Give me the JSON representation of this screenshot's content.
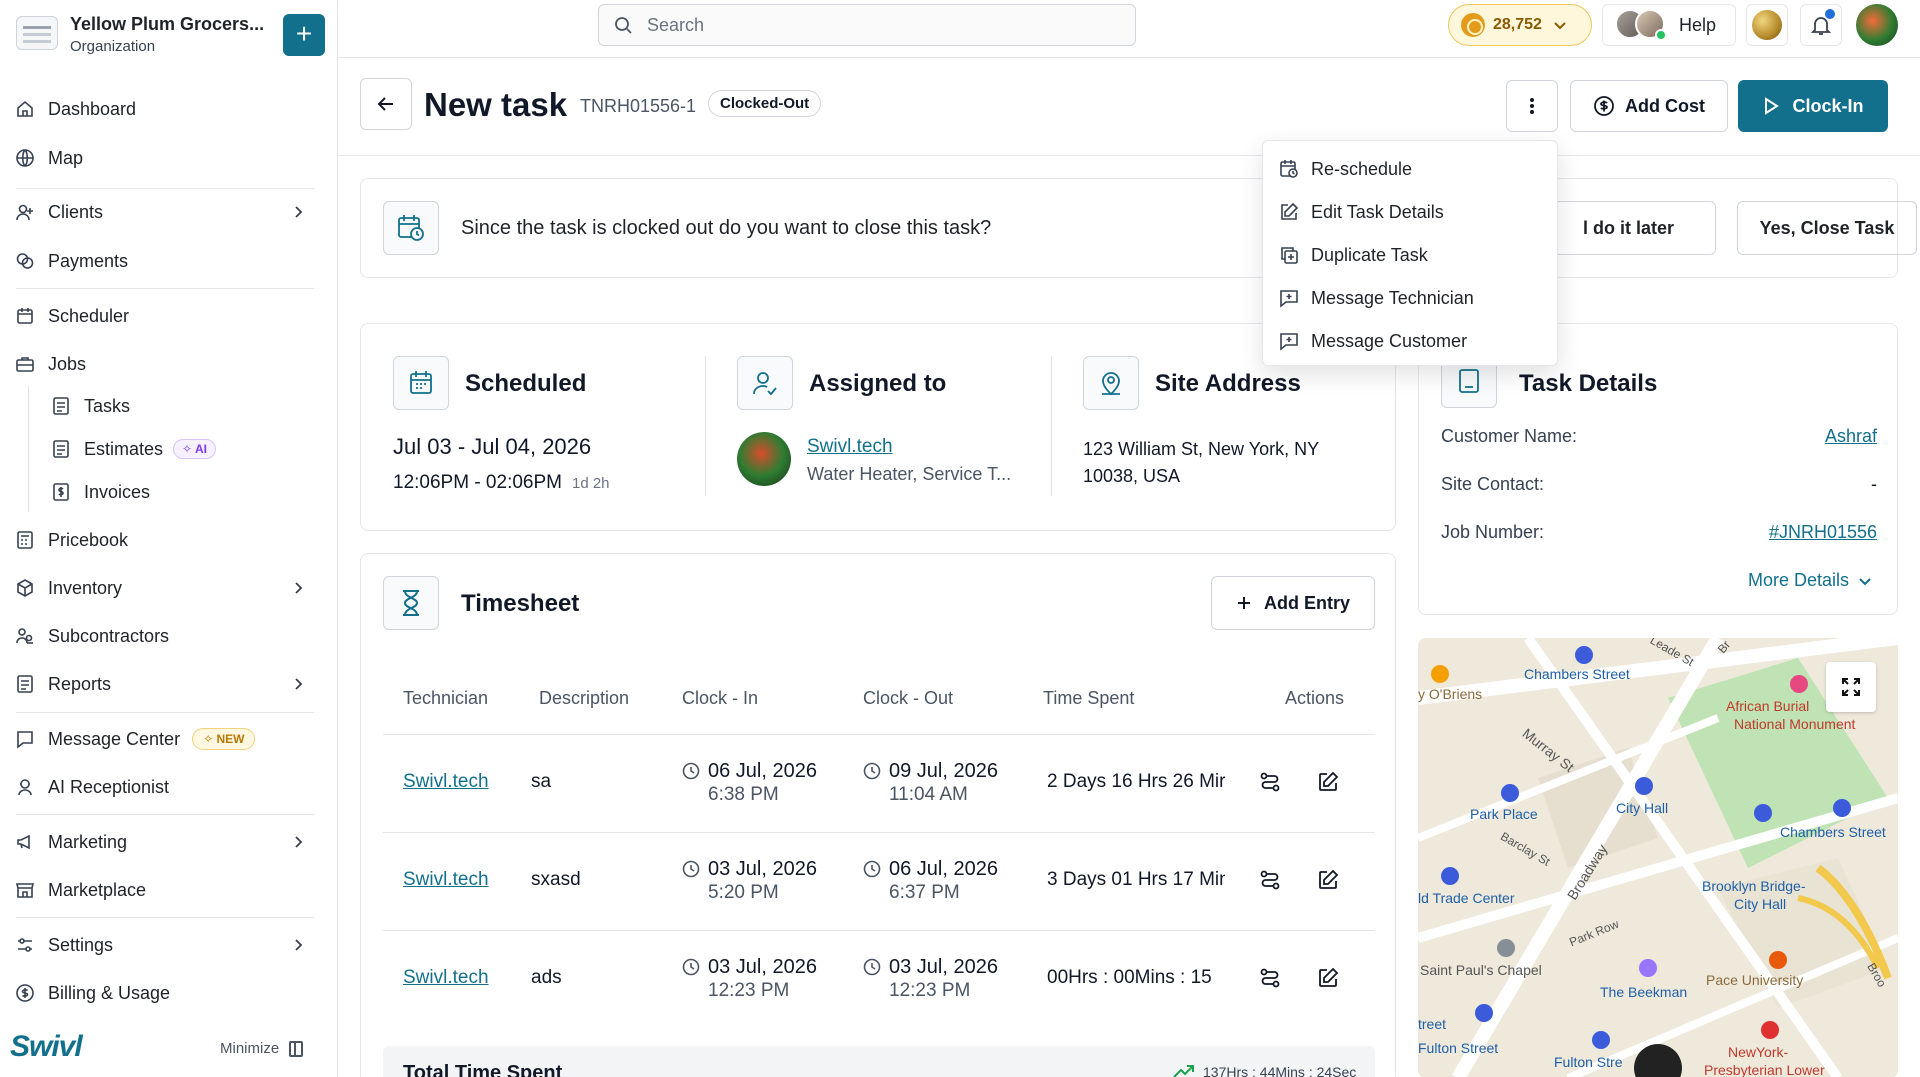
{
  "org": {
    "name": "Yellow Plum Grocers...",
    "subtitle": "Organization"
  },
  "sidebar": {
    "items": [
      {
        "label": "Dashboard"
      },
      {
        "label": "Map"
      },
      {
        "label": "Clients"
      },
      {
        "label": "Payments"
      },
      {
        "label": "Scheduler"
      },
      {
        "label": "Jobs"
      },
      {
        "label": "Tasks"
      },
      {
        "label": "Estimates",
        "badge": "AI"
      },
      {
        "label": "Invoices"
      },
      {
        "label": "Pricebook"
      },
      {
        "label": "Inventory"
      },
      {
        "label": "Subcontractors"
      },
      {
        "label": "Reports"
      },
      {
        "label": "Message Center",
        "badge": "NEW"
      },
      {
        "label": "AI Receptionist"
      },
      {
        "label": "Marketing"
      },
      {
        "label": "Marketplace"
      },
      {
        "label": "Settings"
      },
      {
        "label": "Billing & Usage"
      }
    ],
    "brand": "Swivl",
    "minimize_label": "Minimize"
  },
  "topbar": {
    "search_placeholder": "Search",
    "coins": "28,752",
    "help_label": "Help"
  },
  "header": {
    "title": "New task",
    "task_id": "TNRH01556-1",
    "status": "Clocked-Out",
    "add_cost_label": "Add Cost",
    "clock_in_label": "Clock-In"
  },
  "alert": {
    "text": "Since the task is clocked out do you want to close this task?",
    "later_label": "l do it later",
    "close_label": "Yes, Close Task"
  },
  "menu": {
    "items": [
      {
        "label": "Re-schedule"
      },
      {
        "label": "Edit Task Details"
      },
      {
        "label": "Duplicate Task"
      },
      {
        "label": "Message Technician"
      },
      {
        "label": "Message Customer"
      }
    ]
  },
  "info": {
    "scheduled": {
      "heading": "Scheduled",
      "date": "Jul 03 - Jul 04, 2026",
      "time": "12:06PM - 02:06PM",
      "duration": "1d 2h"
    },
    "assigned": {
      "heading": "Assigned to",
      "name": "Swivl.tech",
      "role": "Water Heater, Service T..."
    },
    "site": {
      "heading": "Site Address",
      "line1": "123 William St, New York, NY",
      "line2": "10038, USA"
    }
  },
  "task_details": {
    "heading": "Task Details",
    "rows": [
      {
        "label": "Customer Name:",
        "value": "Ashraf"
      },
      {
        "label": "Site Contact:",
        "value": "-"
      },
      {
        "label": "Job Number:",
        "value": "#JNRH01556"
      }
    ],
    "more_label": "More Details"
  },
  "map": {
    "labels": {
      "chambers1": "Chambers Street",
      "obriens": "y O'Briens",
      "african1": "African Burial",
      "african2": "National Monument",
      "murray": "Murray St",
      "cityhall": "City Hall",
      "parkplace": "Park Place",
      "chambers2": "Chambers Street",
      "barclay": "Barclay St",
      "broadway": "Broadway",
      "brooklyn1": "Brooklyn Bridge-",
      "brooklyn2": "City Hall",
      "trade": "ld Trade Center",
      "parkrow": "Park Row",
      "stpaul": "Saint Paul's Chapel",
      "pace": "Pace University",
      "beekman": "The Beekman",
      "treet": "treet",
      "fulton1": "Fulton Street",
      "fulton2": "Fulton Stre",
      "nyp1": "NewYork-",
      "nyp2": "Presbyterian Lower",
      "leade": "Leade St",
      "br": "Br",
      "broo": "Broo"
    }
  },
  "timesheet": {
    "title": "Timesheet",
    "add_entry_label": "Add Entry",
    "columns": [
      "Technician",
      "Description",
      "Clock - In",
      "Clock - Out",
      "Time Spent",
      "Actions"
    ],
    "rows": [
      {
        "technician": "Swivl.tech",
        "description": "sa",
        "in_date": "06 Jul, 2026",
        "in_time": "6:38 PM",
        "out_date": "09 Jul, 2026",
        "out_time": "11:04 AM",
        "spent": "2 Days 16 Hrs 26 Mir"
      },
      {
        "technician": "Swivl.tech",
        "description": "sxasd",
        "in_date": "03 Jul, 2026",
        "in_time": "5:20 PM",
        "out_date": "06 Jul, 2026",
        "out_time": "6:37 PM",
        "spent": "3 Days 01 Hrs 17 Min"
      },
      {
        "technician": "Swivl.tech",
        "description": "ads",
        "in_date": "03 Jul, 2026",
        "in_time": "12:23 PM",
        "out_date": "03 Jul, 2026",
        "out_time": "12:23 PM",
        "spent": "00Hrs : 00Mins : 15"
      }
    ],
    "total_label": "Total Time Spent",
    "total_value": "137Hrs : 44Mins : 24Sec"
  },
  "colors": {
    "accent": "#12708c",
    "badge_ai": "#7c3aed",
    "badge_new": "#b77900"
  }
}
